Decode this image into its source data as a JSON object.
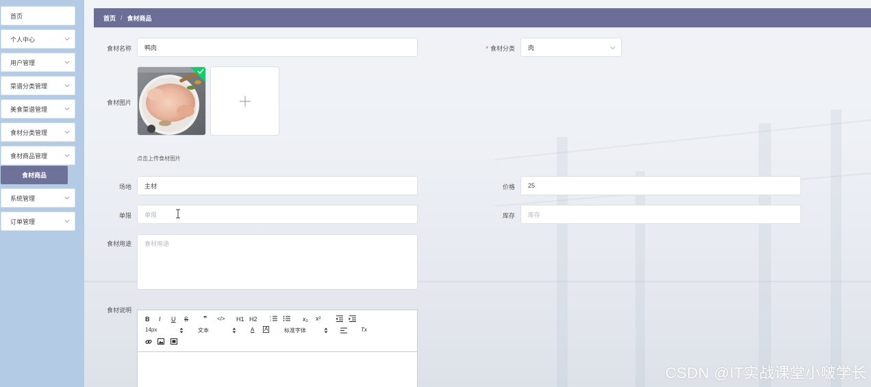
{
  "sidebar": {
    "items": [
      {
        "label": "首页",
        "has_arrow": false
      },
      {
        "label": "个人中心",
        "has_arrow": true
      },
      {
        "label": "用户管理",
        "has_arrow": true
      },
      {
        "label": "菜谱分类管理",
        "has_arrow": true
      },
      {
        "label": "美食菜谱管理",
        "has_arrow": true
      },
      {
        "label": "食材分类管理",
        "has_arrow": true
      },
      {
        "label": "食材商品管理",
        "has_arrow": true
      },
      {
        "label": "系统管理",
        "has_arrow": true
      },
      {
        "label": "订单管理",
        "has_arrow": true
      }
    ],
    "active_sub_item": "食材商品"
  },
  "breadcrumb": {
    "home": "首页",
    "separator": "/",
    "current": "食材商品"
  },
  "form": {
    "name": {
      "label": "食材名称",
      "value": "鸭肉"
    },
    "category": {
      "label": "食材分类",
      "required_mark": "*",
      "value": "肉"
    },
    "image": {
      "label": "食材图片",
      "hint": "点击上传食材图片",
      "plus": "+"
    },
    "origin": {
      "label": "场地",
      "value": "主材"
    },
    "price": {
      "label": "价格",
      "value": "25"
    },
    "limit": {
      "label": "单限",
      "placeholder": "单限"
    },
    "stock": {
      "label": "库存",
      "placeholder": "库存"
    },
    "usage": {
      "label": "食材用途",
      "placeholder": "食材用途"
    },
    "description": {
      "label": "食材说明"
    }
  },
  "editor_toolbar": {
    "bold": "B",
    "italic": "I",
    "underline": "U",
    "strike": "S",
    "quote": "❞",
    "code": "</>",
    "h1": "H1",
    "h2": "H2",
    "subscript": "x₂",
    "superscript": "x²",
    "font_size": "14px",
    "text_type": "文本",
    "font_family": "标准字体",
    "font_color": "A",
    "bg_color": "A",
    "clear_format": "Tx"
  },
  "watermark": "CSDN @IT实战课堂小啵学长",
  "colors": {
    "sidebar_bg": "#b4cbe6",
    "accent": "#6b6f98",
    "required": "#e2443c",
    "upload_check": "#13ce66"
  },
  "icons": [
    "chevron-down-icon",
    "plus-icon",
    "check-icon",
    "text-cursor-icon"
  ]
}
